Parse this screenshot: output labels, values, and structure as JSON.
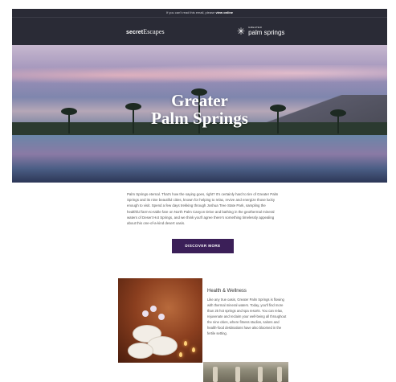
{
  "topbar": {
    "text": "If you can't read this email, please ",
    "link": "view online"
  },
  "header": {
    "logo_left_bold": "secret",
    "logo_left": "Escapes",
    "logo_right_small": "GREATER",
    "logo_right": "palm springs"
  },
  "hero": {
    "title_line1": "Greater",
    "title_line2": "Palm Springs"
  },
  "intro": {
    "text": "Palm Springs eternal. That's how the saying goes, right? It's certainly hard to tire of Greater Palm Springs and its nine beautiful cities, known for helping to relax, revive and energize those lucky enough to visit. Spend a few days trekking through Joshua Tree State Park, sampling the healthful farm-to-table fare on North Palm Canyon Drive and bathing in the geothermal mineral waters of Desert Hot Springs, and we think you'll agree there's something timelessly appealing about this one-of-a-kind desert oasis."
  },
  "button": {
    "label": "DISCOVER MORE"
  },
  "card": {
    "title": "Health & Wellness",
    "text": "Like any true oasis, Greater Palm Springs is flowing with thermal mineral waters. Today, you'll find more than 25 hot springs and spa resorts. You can relax, rejuvenate and reclaim your well-being all throughout the nine cities, where fitness studios, salons and health-food destinations have also bloomed in the fertile setting."
  },
  "colors": {
    "header_bg": "#2a2b36",
    "button_bg": "#3b1f58"
  },
  "icons": {
    "logo_mark": "palm-burst-icon"
  }
}
